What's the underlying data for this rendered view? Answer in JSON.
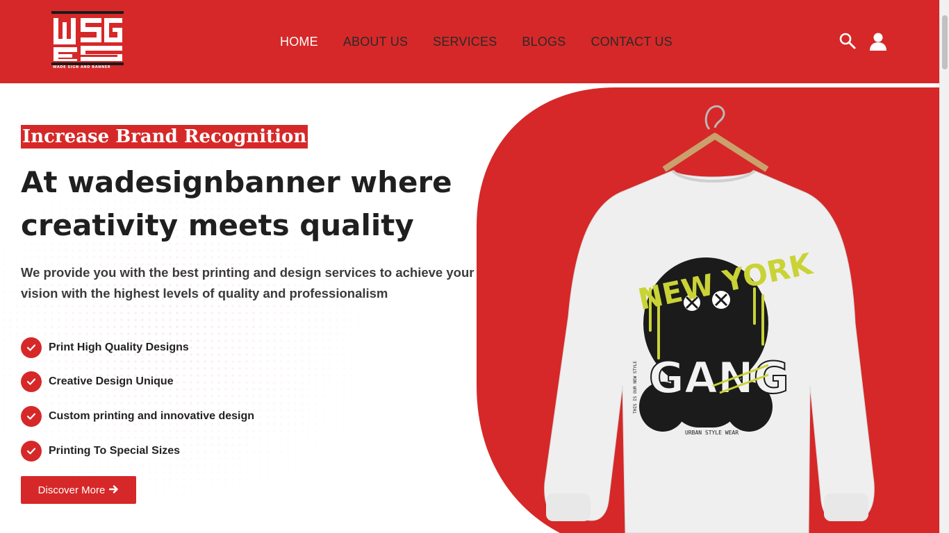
{
  "brand": {
    "logo_subtitle": "WADE SIGN AND BANNER",
    "accent_color": "#d62828"
  },
  "nav": {
    "items": [
      {
        "label": "HOME",
        "active": true
      },
      {
        "label": "ABOUT US",
        "active": false
      },
      {
        "label": "SERVICES",
        "active": false
      },
      {
        "label": "BLOGS",
        "active": false
      },
      {
        "label": "CONTACT US",
        "active": false
      }
    ]
  },
  "header_icons": {
    "search": "search-icon",
    "account": "user-icon"
  },
  "hero": {
    "tagline": "Increase Brand Recognition",
    "title_line1": "At wadesignbanner where",
    "title_line2": "creativity meets quality",
    "description": "We provide you with the best printing and design services to achieve your vision with the highest levels of quality and professionalism",
    "features": [
      "Print High Quality Designs",
      "Creative Design Unique",
      "Custom printing and innovative design",
      "Printing To Special Sizes"
    ],
    "cta_label": "Discover More",
    "cta_icon": "arrow-right-icon"
  },
  "product_image": {
    "print_text_1": "NEW YORK",
    "print_text_2": "GANG",
    "print_text_3": "URBAN STYLE WEAR",
    "print_text_4": "THIS IS OUR NEW STYLE"
  }
}
